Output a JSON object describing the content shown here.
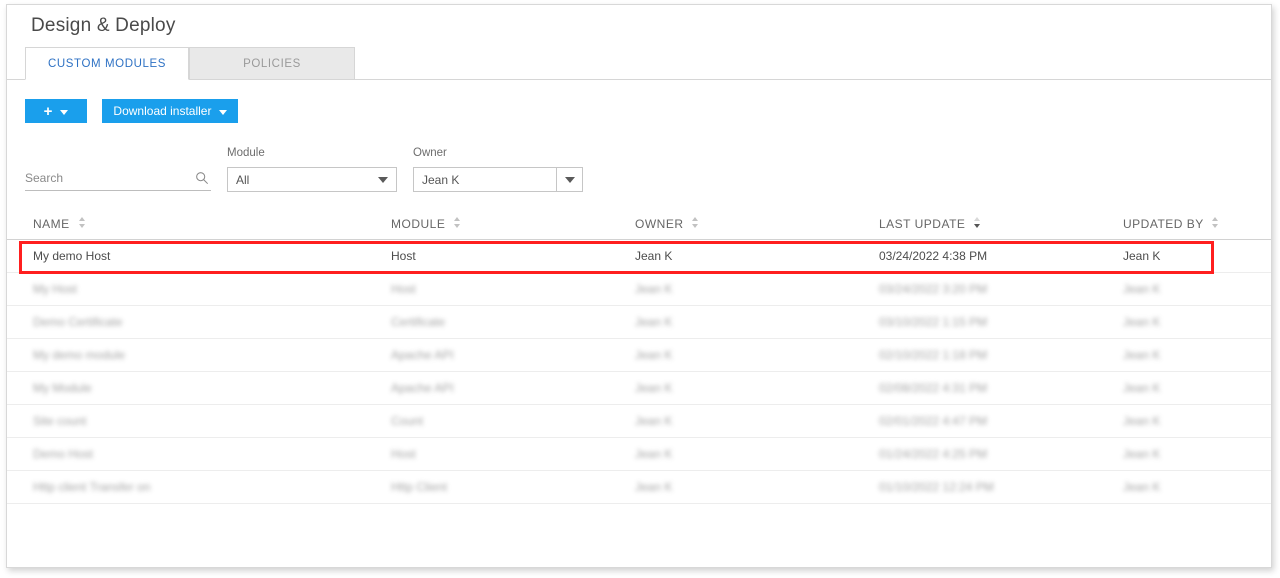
{
  "window": {
    "title": "Design & Deploy"
  },
  "tabs": [
    {
      "label": "CUSTOM MODULES",
      "active": true
    },
    {
      "label": "POLICIES",
      "active": false
    }
  ],
  "toolbar": {
    "add_label": "+",
    "add_icon": "plus-icon",
    "download_label": "Download installer",
    "dropdown_icon": "caret-down-icon",
    "accent_color": "#1a9fec"
  },
  "filters": {
    "search": {
      "placeholder": "Search",
      "value": "",
      "icon": "search-icon"
    },
    "module": {
      "label": "Module",
      "value": "All",
      "icon": "chevron-down-icon"
    },
    "owner": {
      "label": "Owner",
      "value": "Jean K",
      "icon": "chevron-down-icon"
    }
  },
  "table": {
    "columns": [
      {
        "label": "NAME",
        "sort": "none"
      },
      {
        "label": "MODULE",
        "sort": "none"
      },
      {
        "label": "OWNER",
        "sort": "none"
      },
      {
        "label": "LAST UPDATE",
        "sort": "desc"
      },
      {
        "label": "UPDATED BY",
        "sort": "none"
      }
    ],
    "rows": [
      {
        "name": "My demo Host",
        "module": "Host",
        "owner": "Jean K",
        "last_update": "03/24/2022 4:38 PM",
        "updated_by": "Jean K",
        "redacted": false,
        "highlighted": true
      },
      {
        "name": "My Host",
        "module": "Host",
        "owner": "Jean K",
        "last_update": "03/24/2022 3:20 PM",
        "updated_by": "Jean K",
        "redacted": true,
        "highlighted": false
      },
      {
        "name": "Demo Certificate",
        "module": "Certificate",
        "owner": "Jean K",
        "last_update": "03/10/2022 1:15 PM",
        "updated_by": "Jean K",
        "redacted": true,
        "highlighted": false
      },
      {
        "name": "My demo module",
        "module": "Apache API",
        "owner": "Jean K",
        "last_update": "02/10/2022 1:18 PM",
        "updated_by": "Jean K",
        "redacted": true,
        "highlighted": false
      },
      {
        "name": "My Module",
        "module": "Apache API",
        "owner": "Jean K",
        "last_update": "02/08/2022 4:31 PM",
        "updated_by": "Jean K",
        "redacted": true,
        "highlighted": false
      },
      {
        "name": "Site count",
        "module": "Count",
        "owner": "Jean K",
        "last_update": "02/01/2022 4:47 PM",
        "updated_by": "Jean K",
        "redacted": true,
        "highlighted": false
      },
      {
        "name": "Demo Host",
        "module": "Host",
        "owner": "Jean K",
        "last_update": "01/24/2022 4:25 PM",
        "updated_by": "Jean K",
        "redacted": true,
        "highlighted": false
      },
      {
        "name": "Http client Transfer on",
        "module": "Http Client",
        "owner": "Jean K",
        "last_update": "01/10/2022 12:24 PM",
        "updated_by": "Jean K",
        "redacted": true,
        "highlighted": false
      }
    ]
  },
  "annotation": {
    "highlight_color": "#ff1f1f"
  }
}
